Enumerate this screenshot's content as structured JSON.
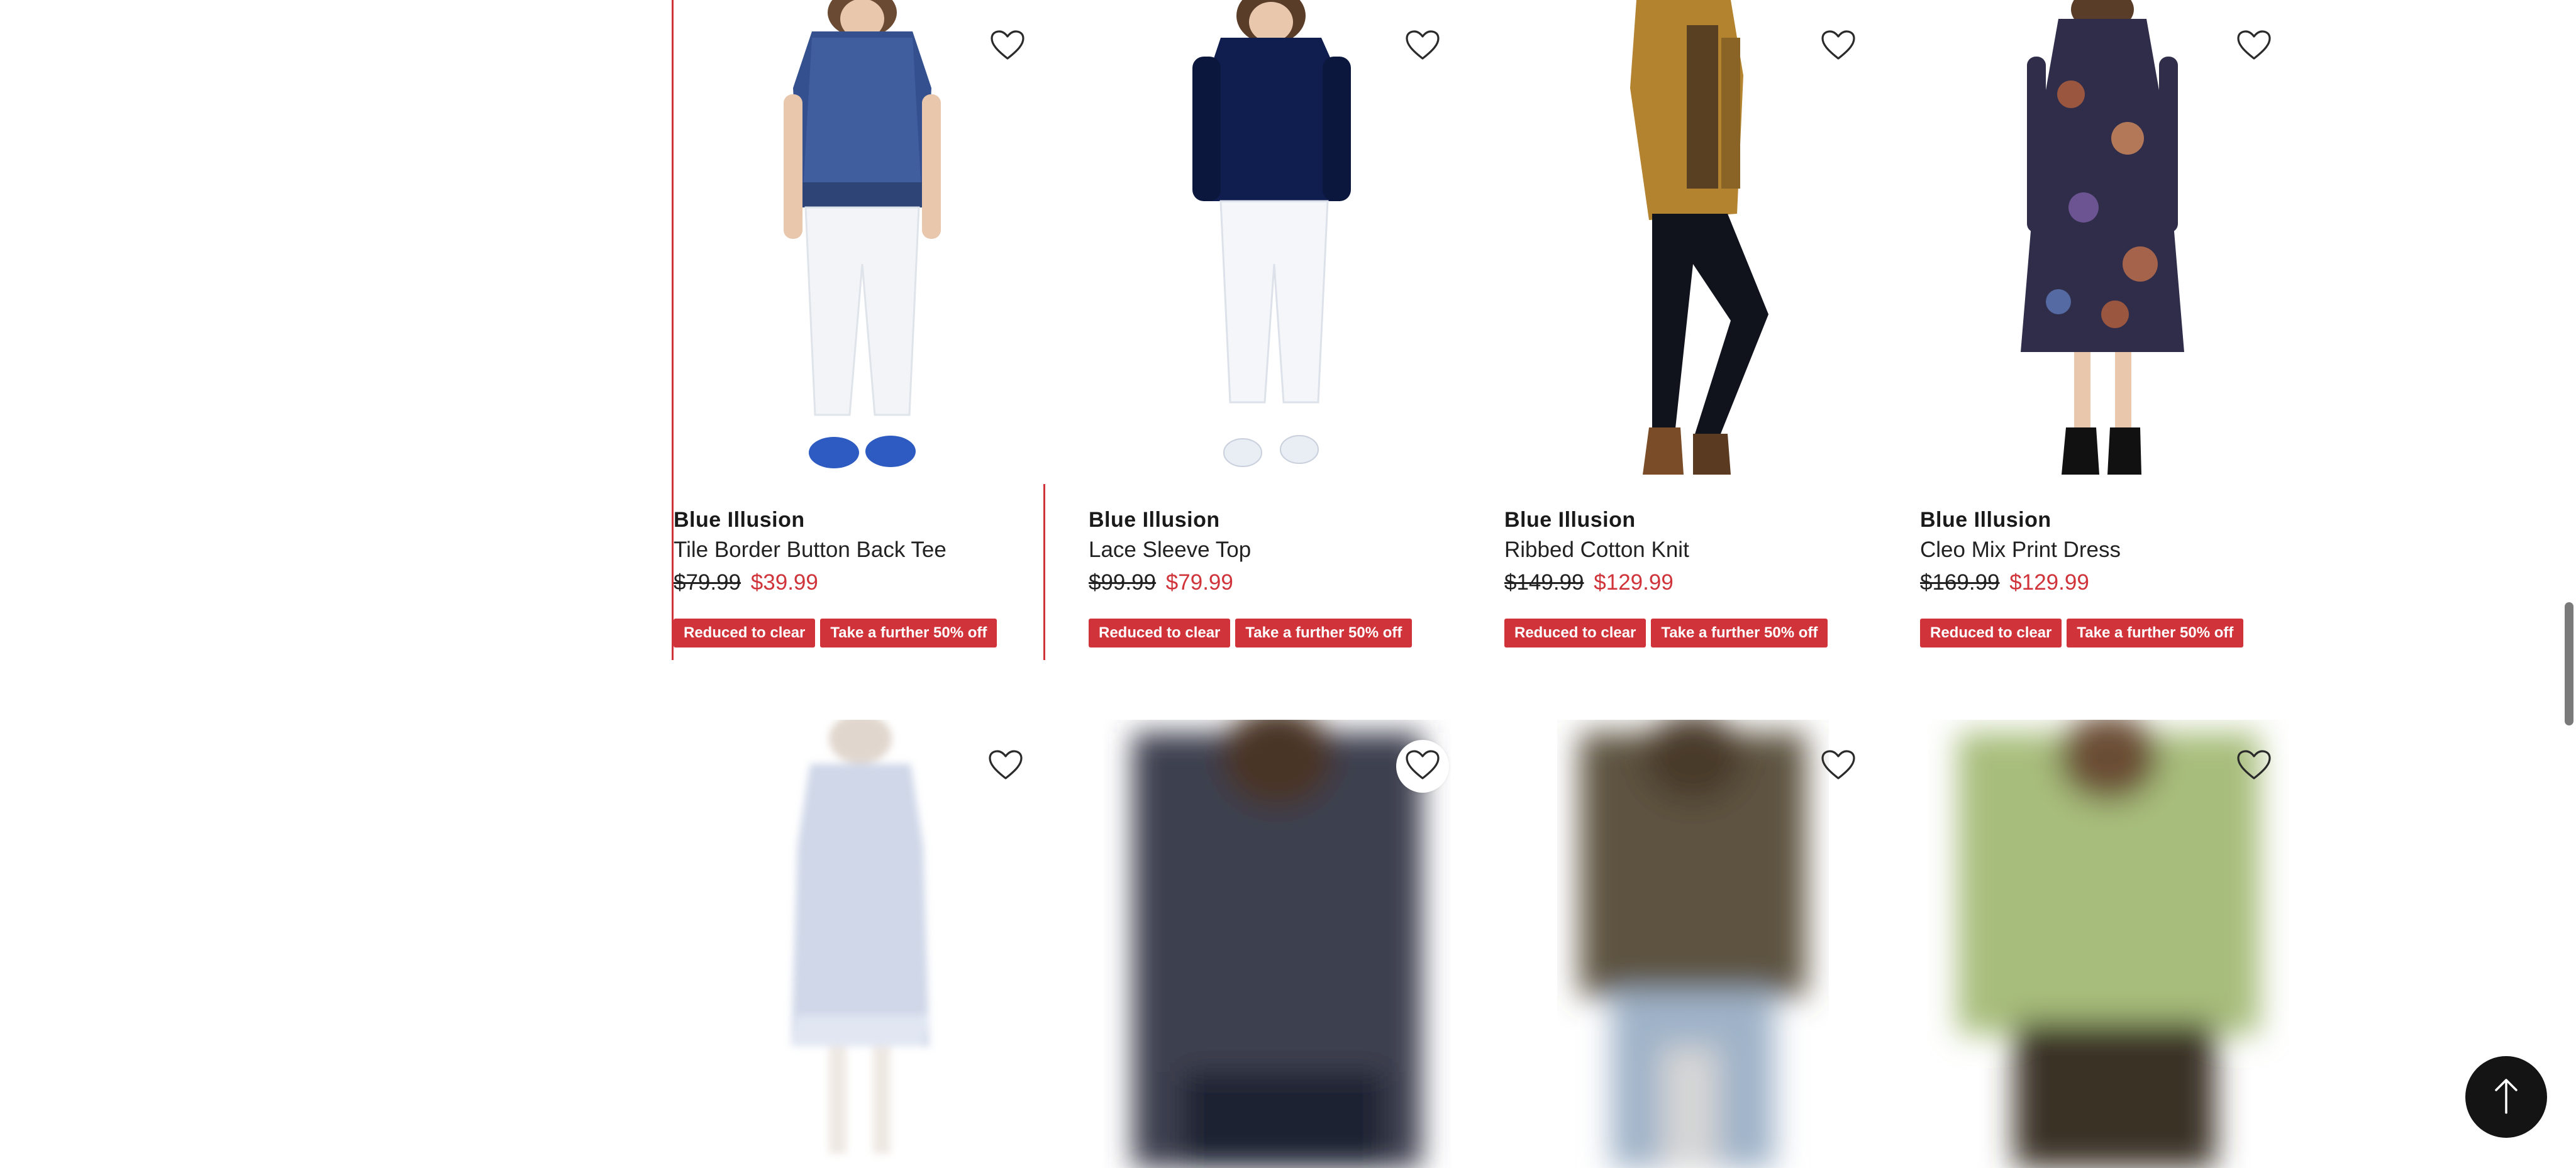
{
  "products": [
    {
      "brand": "Blue Illusion",
      "name": "Tile Border Button Back Tee",
      "price_original": "$79.99",
      "price_sale": "$39.99",
      "badges": [
        "Reduced to clear",
        "Take a further 50% off"
      ]
    },
    {
      "brand": "Blue Illusion",
      "name": "Lace Sleeve Top",
      "price_original": "$99.99",
      "price_sale": "$79.99",
      "badges": [
        "Reduced to clear",
        "Take a further 50% off"
      ]
    },
    {
      "brand": "Blue Illusion",
      "name": "Ribbed Cotton Knit",
      "price_original": "$149.99",
      "price_sale": "$129.99",
      "badges": [
        "Reduced to clear",
        "Take a further 50% off"
      ]
    },
    {
      "brand": "Blue Illusion",
      "name": "Cleo Mix Print Dress",
      "price_original": "$169.99",
      "price_sale": "$129.99",
      "badges": [
        "Reduced to clear",
        "Take a further 50% off"
      ]
    }
  ],
  "icons": {
    "wishlist": "heart-outline-icon",
    "back_to_top": "arrow-up-icon"
  },
  "colors": {
    "accent": "#d0343a",
    "badge_text": "#ffffff",
    "back_to_top_bg": "#141414"
  }
}
